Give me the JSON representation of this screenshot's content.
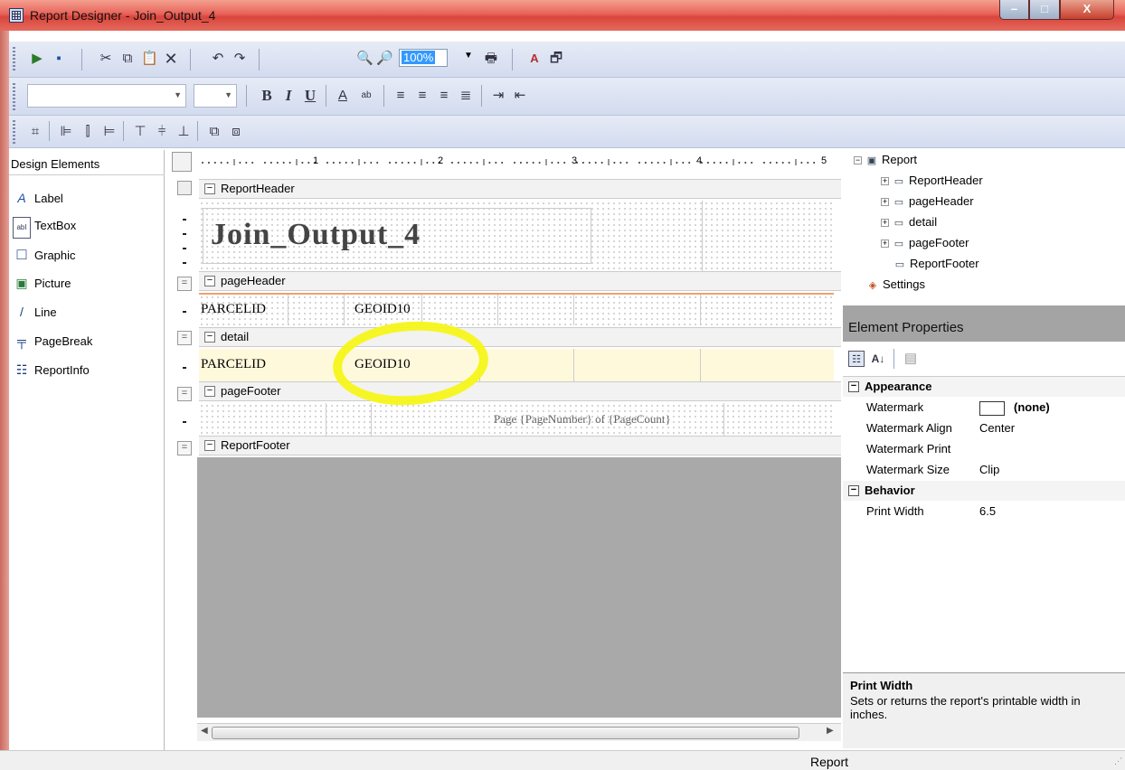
{
  "window": {
    "title": "Report Designer - Join_Output_4",
    "min": "–",
    "max": "□",
    "close": "X"
  },
  "toolbar": {
    "zoom": "100%"
  },
  "design_elements": {
    "header": "Design Elements",
    "items": [
      {
        "label": "Label",
        "icon": "label-icon",
        "glyph": "A"
      },
      {
        "label": "TextBox",
        "icon": "textbox-icon",
        "glyph": "abI"
      },
      {
        "label": "Graphic",
        "icon": "graphic-icon",
        "glyph": "□"
      },
      {
        "label": "Picture",
        "icon": "picture-icon",
        "glyph": "▣"
      },
      {
        "label": "Line",
        "icon": "line-icon",
        "glyph": "/"
      },
      {
        "label": "PageBreak",
        "icon": "pagebreak-icon",
        "glyph": "╤"
      },
      {
        "label": "ReportInfo",
        "icon": "reportinfo-icon",
        "glyph": "☷"
      }
    ]
  },
  "ruler": {
    "labels": [
      "1",
      "2",
      "3",
      "4",
      "5"
    ]
  },
  "bands": {
    "report_header": "ReportHeader",
    "page_header": "pageHeader",
    "detail": "detail",
    "page_footer": "pageFooter",
    "report_footer": "ReportFooter"
  },
  "report": {
    "title": "Join_Output_4",
    "header_fields": [
      "PARCELID",
      "GEOID10"
    ],
    "detail_fields": [
      "PARCELID",
      "GEOID10"
    ],
    "footer_text": "Page {PageNumber} of {PageCount}"
  },
  "tree": {
    "root": "Report",
    "children": [
      "ReportHeader",
      "pageHeader",
      "detail",
      "pageFooter",
      "ReportFooter"
    ],
    "settings": "Settings"
  },
  "element_properties": {
    "header": "Element Properties",
    "categories": [
      {
        "name": "Appearance",
        "props": [
          {
            "name": "Watermark",
            "value": "(none)"
          },
          {
            "name": "Watermark Align",
            "value": "Center"
          },
          {
            "name": "Watermark Print",
            "value": ""
          },
          {
            "name": "Watermark Size",
            "value": "Clip"
          }
        ]
      },
      {
        "name": "Behavior",
        "props": [
          {
            "name": "Print Width",
            "value": "6.5"
          }
        ]
      }
    ],
    "help_title": "Print Width",
    "help_desc": "Sets or returns the report's printable width in inches."
  },
  "status": {
    "text": "Report"
  },
  "colors": {
    "highlight": "#f5f51a",
    "title_gradient": "#e8635a",
    "toolbar": "#d3dbef"
  }
}
